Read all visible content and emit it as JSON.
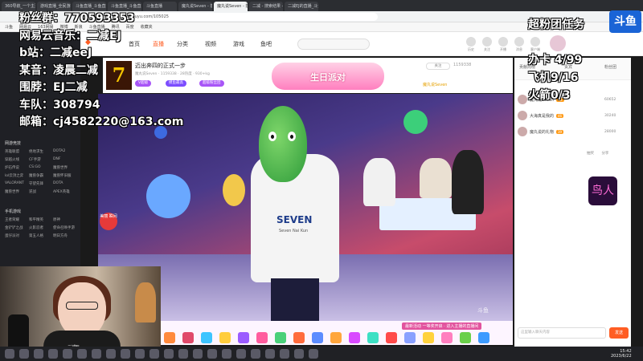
{
  "browser": {
    "tabs": [
      "360导航_一个主页，整个世界",
      "游戏直播_全民游戏直播_斗鱼",
      "斗鱼直播_斗鱼直播_斗鱼",
      "斗鱼直播_斗鱼直播_斗鱼",
      "斗鱼直播",
      "魔丸说Seven - 摸鱼直播",
      "魔丸说Seven - 摸鱼直播",
      "二减 - 搜索结果 - 斗鱼",
      "二减EJ的直播_斗鱼直播"
    ],
    "url": "www.douyu.com/105025",
    "bookmarks": [
      "斗鱼",
      "网易云",
      "163网易",
      "微博",
      "新浪",
      "斗鱼直播",
      "腾讯",
      "百度",
      "收藏夹"
    ]
  },
  "site": {
    "nav": [
      "首页",
      "直播",
      "分类",
      "视频",
      "游戏",
      "鱼吧"
    ],
    "header_icons": [
      "历史",
      "关注",
      "开播",
      "消息",
      "客户端"
    ]
  },
  "sidebar": {
    "groups": [
      {
        "title": "网游竞技",
        "items": [
          "英雄联盟",
          "绝地求生",
          "DOTA2",
          "穿越火线",
          "CF手游",
          "DNF",
          "炉石传说",
          "CS:GO",
          "魔兽世界",
          "lol云顶之弈",
          "魔兽争霸",
          "魔兽怀旧服",
          "VALORANT",
          "守望先锋",
          "DOTA",
          "魔兽世界",
          "逆战",
          "APEX英雄"
        ]
      },
      {
        "title": "手机游戏",
        "items": [
          "王者荣耀",
          "和平精英",
          "原神",
          "金铲铲之战",
          "火影忍者",
          "使命召唤手游",
          "蛋仔派对",
          "第五人格",
          "明日方舟"
        ]
      }
    ]
  },
  "room": {
    "title": "迈出奔四的正式一步",
    "meta": "魔丸说Seven · 1159338 · 28热度 · 930+kg",
    "owner_tag": "魔丸说Seven",
    "birthday_banner": "生日派对",
    "follow": "关注",
    "fans": "1159338",
    "club_label": "魔丸说Seven",
    "tags": [
      "V超级",
      "摸鱼最高",
      "超级粉丝团"
    ]
  },
  "video": {
    "shirt_text": "SEVEN",
    "shirt_sub": "Seven Nai Kun",
    "watermark": "斗鱼",
    "badge": "美丽 瞬间",
    "corner": "主播正在直播"
  },
  "gift_bar": {
    "event": "最新活动 一等奖开启 · 进入主播的直播间"
  },
  "rank": {
    "tabs": [
      "贡献周榜",
      "贵宾",
      "粉丝团"
    ],
    "entries": [
      {
        "name": "魔丸说Seven",
        "level": "52",
        "score": "60652"
      },
      {
        "name": "大海真是我的",
        "level": "46",
        "score": "30240"
      },
      {
        "name": "魔丸说的礼物",
        "level": "39",
        "score": "28000"
      }
    ],
    "actions": [
      "抽奖",
      "分享"
    ],
    "ad": "鸟人"
  },
  "chat": {
    "placeholder": "这里输入聊天内容",
    "send": "发送"
  },
  "overlay": {
    "left": [
      "粉丝群：770593353",
      "网易云音乐：二减EJ",
      "b站：二减eeJ",
      "某音：凌晨二减",
      "围脖：EJ二减",
      "车队：308794",
      "邮箱：cj4582220@163.com"
    ],
    "right_title": "超粉团任务",
    "right_logo": "斗鱼",
    "right": [
      "办卡 4/99",
      "飞机9/16",
      "火箭0/3"
    ]
  },
  "webcam": {
    "name": "二减EJ"
  },
  "taskbar": {
    "time": "15:42",
    "date": "2023/6/22"
  }
}
